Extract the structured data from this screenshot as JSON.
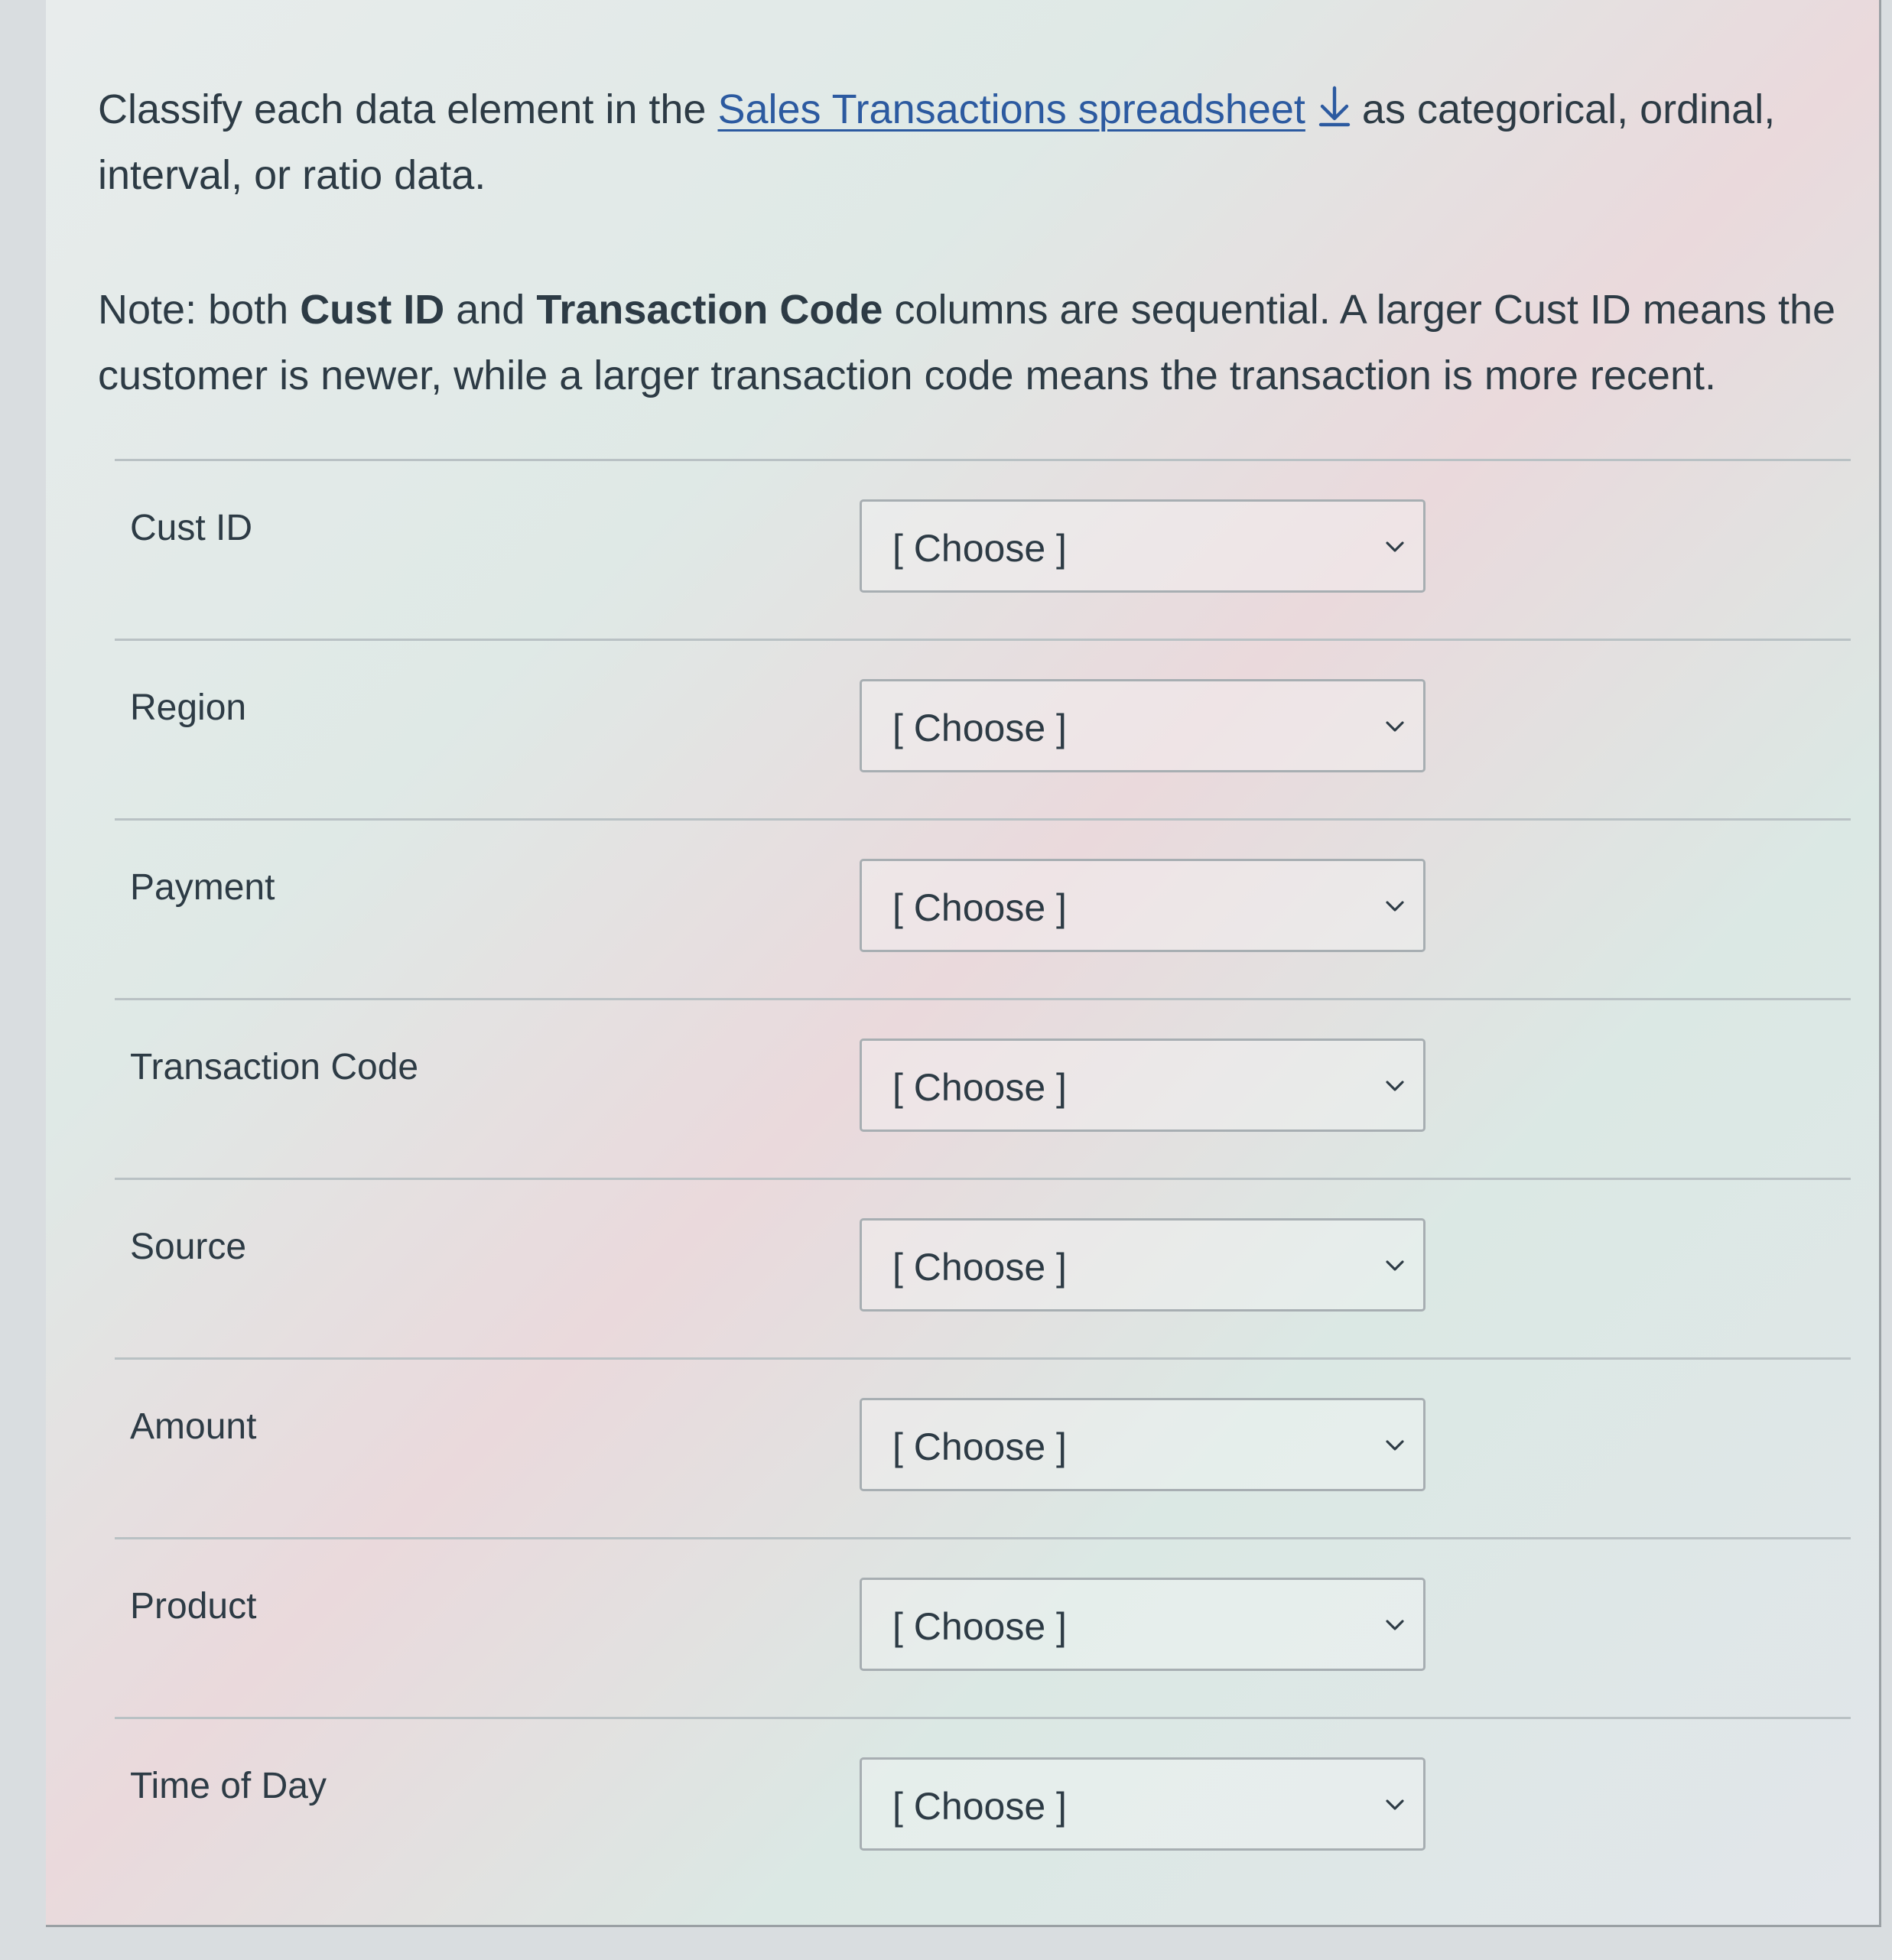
{
  "question": {
    "prefix": "Classify each data element in the",
    "link_text": "Sales Transactions spreadsheet",
    "suffix": "as categorical, ordinal, interval, or ratio data.",
    "note_prefix": "Note: both",
    "note_bold_1": "Cust ID",
    "note_and": "and",
    "note_bold_2": "Transaction Code",
    "note_suffix": "columns are sequential. A larger Cust ID means the customer is newer, while a larger transaction code means the transaction is more recent."
  },
  "rows": [
    {
      "label": "Cust ID",
      "selected": "[ Choose ]"
    },
    {
      "label": "Region",
      "selected": "[ Choose ]"
    },
    {
      "label": "Payment",
      "selected": "[ Choose ]"
    },
    {
      "label": "Transaction Code",
      "selected": "[ Choose ]"
    },
    {
      "label": "Source",
      "selected": "[ Choose ]"
    },
    {
      "label": "Amount",
      "selected": "[ Choose ]"
    },
    {
      "label": "Product",
      "selected": "[ Choose ]"
    },
    {
      "label": "Time of Day",
      "selected": "[ Choose ]"
    }
  ],
  "colors": {
    "text": "#2d3b45",
    "link": "#2c5aa0",
    "border": "#a7aeb2"
  },
  "icons": {
    "download": "download-arrow-icon",
    "dropdown": "chevron-down-icon"
  }
}
